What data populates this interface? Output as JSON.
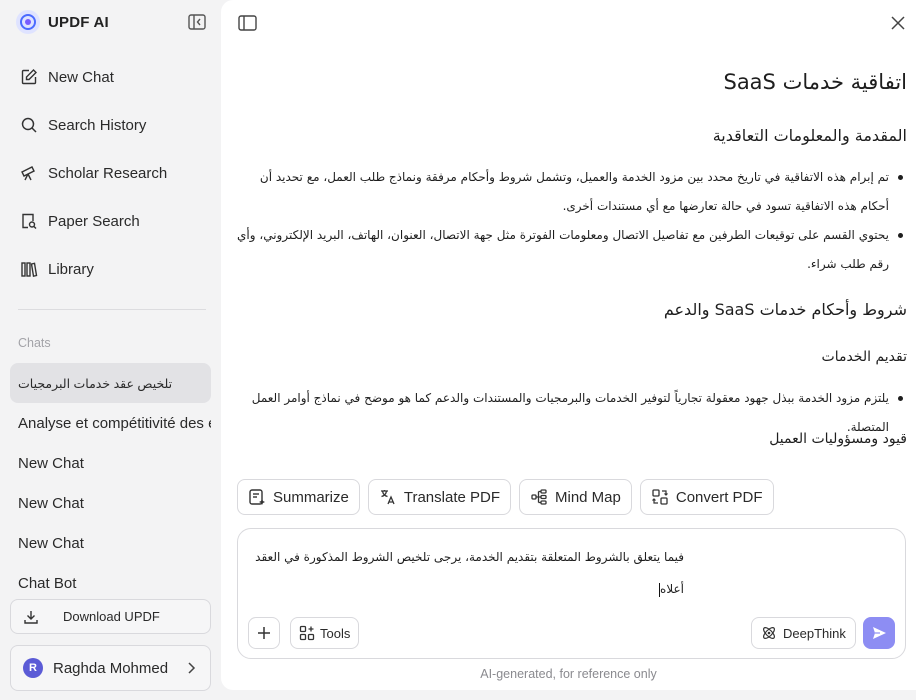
{
  "brand": {
    "name": "UPDF AI"
  },
  "nav": [
    {
      "label": "New Chat",
      "icon": "edit-icon"
    },
    {
      "label": "Search History",
      "icon": "search-icon"
    },
    {
      "label": "Scholar Research",
      "icon": "telescope-icon"
    },
    {
      "label": "Paper Search",
      "icon": "doc-search-icon"
    },
    {
      "label": "Library",
      "icon": "library-icon"
    }
  ],
  "chats_section": {
    "label": "Chats"
  },
  "chats": [
    "تلخيص عقد خدمات البرمجيات",
    "Analyse et compétitivité des entreprises",
    "New Chat",
    "New Chat",
    "New Chat",
    "Chat Bot"
  ],
  "download": {
    "label": "Download UPDF"
  },
  "user": {
    "initial": "R",
    "name": "Raghda Mohmed"
  },
  "doc": {
    "title": "اتفاقية خدمات SaaS",
    "sections": [
      {
        "heading": "المقدمة والمعلومات التعاقدية",
        "bullets": [
          "تم إبرام هذه الاتفاقية في تاريخ محدد بين مزود الخدمة والعميل، وتشمل شروط وأحكام مرفقة ونماذج طلب العمل، مع تحديد أن أحكام هذه الاتفاقية تسود في حالة تعارضها مع أي مستندات أخرى.",
          "يحتوي القسم على توقيعات الطرفين مع تفاصيل الاتصال ومعلومات الفوترة مثل جهة الاتصال، العنوان، الهاتف، البريد الإلكتروني، وأي رقم طلب شراء."
        ]
      },
      {
        "heading": "شروط وأحكام خدمات SaaS والدعم",
        "sub_heading": "تقديم الخدمات",
        "bullets": [
          "يلتزم مزود الخدمة ببذل جهود معقولة تجارياً لتوفير الخدمات والبرمجيات والمستندات والدعم كما هو موضح في نماذج أوامر العمل المتصلة."
        ]
      },
      {
        "sub_heading": "قيود ومسؤوليات العميل"
      }
    ]
  },
  "quick_actions": [
    {
      "label": "Summarize",
      "icon": "summarize-icon"
    },
    {
      "label": "Translate PDF",
      "icon": "translate-icon"
    },
    {
      "label": "Mind Map",
      "icon": "mindmap-icon"
    },
    {
      "label": "Convert PDF",
      "icon": "convert-icon"
    }
  ],
  "composer": {
    "line1": "فيما يتعلق بالشروط المتعلقة بتقديم الخدمة، يرجى تلخيص الشروط المذكورة في العقد",
    "line2": "أعلاه",
    "tools_label": "Tools",
    "deepthink_label": "DeepThink"
  },
  "footer_note": "AI-generated, for reference only",
  "colors": {
    "accent": "#8d8df3",
    "sidebar_bg": "#f3f3f4",
    "active_chat_bg": "#e2e2e5"
  }
}
